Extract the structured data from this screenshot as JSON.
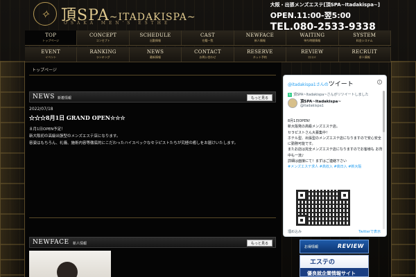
{
  "header": {
    "logo_main": "頂SPA",
    "logo_tail": "~ITADAKISPA~",
    "logo_sub": "OSAKA MEN'S ESTHE",
    "area": "大阪・出張メンズエステ[頂SPA~Itadakispa~]",
    "hours": "OPEN.11:00-翌5:00",
    "tel": "TEL.080-2533-9338"
  },
  "nav": {
    "row1": [
      {
        "en": "TOP",
        "ja": "トップページ"
      },
      {
        "en": "CONCEPT",
        "ja": "コンセプト"
      },
      {
        "en": "SCHEDULE",
        "ja": "出勤情報"
      },
      {
        "en": "CAST",
        "ja": "在籍一覧"
      },
      {
        "en": "NEWFACE",
        "ja": "新人情報"
      },
      {
        "en": "WAITING",
        "ja": "待ち時間情報"
      },
      {
        "en": "SYSTEM",
        "ja": "料金システム"
      }
    ],
    "row2": [
      {
        "en": "EVENT",
        "ja": "イベント"
      },
      {
        "en": "RANKING",
        "ja": "ランキング"
      },
      {
        "en": "NEWS",
        "ja": "最新情報"
      },
      {
        "en": "CONTACT",
        "ja": "お問い合わせ"
      },
      {
        "en": "RESERVE",
        "ja": "ネット予約"
      },
      {
        "en": "REVIEW",
        "ja": "口コミ"
      },
      {
        "en": "RECRUIT",
        "ja": "求人情報"
      }
    ]
  },
  "breadcrumb": "トップページ",
  "news": {
    "title": "NEWS",
    "subtitle": "新着情報",
    "more": "もっと見る",
    "date": "2022/07/18",
    "headline": "☆☆☆8月1日 GRAND OPEN☆☆☆",
    "body": [
      "８月1日OPEN予定！",
      "新大阪初の高級出張型のメンズエステ店になります。",
      "容姿はもちろん、礼儀、施術内容等徹底的にこだわったハイスペックなセラピストたちが究極の癒しをお届けいたします。"
    ]
  },
  "newface": {
    "title": "NEWFACE",
    "subtitle": "新人情報",
    "more": "もっと見る"
  },
  "twitter": {
    "header_user": "@itadakispa1",
    "header_suffix": "さんの",
    "header_title": "ツイート",
    "retweet_line": "頂SPA~Itadakispa~さんがリツイートしました",
    "name": "頂SPA~Itadakispa~",
    "handle": "@itadakispa1",
    "lines": [
      "8月1日OPEN！",
      "新大阪発の高級メンズエステ店。",
      "セラピストさん大募集中！",
      "ホテル型、出張型のメンズエステ店になりますので安心安全に勤務可能です。",
      "またお店は完全メンズエステ店になりますのでお客様も お背中も一流♪",
      "詳細は面接にて！まずはご連絡下さい"
    ],
    "hashtags": "#メンズエステ求人 #高収入 #高日入 #新大阪",
    "foot_left": "埋め込み",
    "foot_right": "Twitterで表示"
  },
  "banners": {
    "b1_pre": "お得情報",
    "b1_text": "REVIEW",
    "b2_top": "エステの",
    "b2_bottom": "優良就企業情報サイト"
  }
}
